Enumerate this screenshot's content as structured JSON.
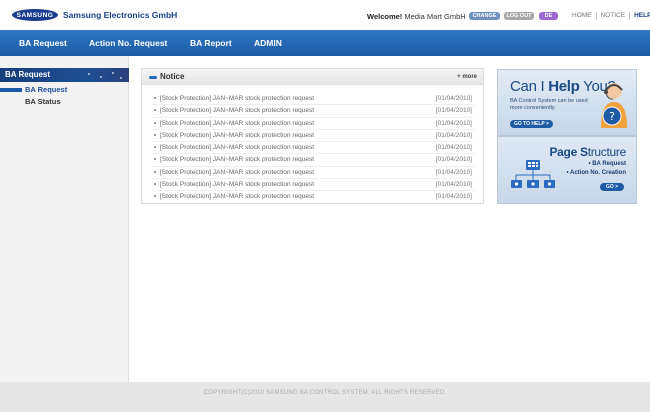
{
  "header": {
    "logo_text": "SAMSUNG",
    "brand": "Samsung Electronics GmbH",
    "welcome_label": "Welcome!",
    "user": "Media Mart GmbH",
    "change_label": "CHANGE",
    "logout_label": "LOG OUT",
    "lang_label": "DE",
    "links": {
      "home": "HOME",
      "notice": "NOTICE",
      "help": "HELP"
    }
  },
  "nav": {
    "items": [
      "BA Request",
      "Action No. Request",
      "BA Report",
      "ADMIN"
    ]
  },
  "sidebar": {
    "title": "BA Request",
    "items": [
      {
        "label": "BA Request",
        "active": true
      },
      {
        "label": "BA Status",
        "active": false
      }
    ]
  },
  "notice": {
    "title": "Notice",
    "more_label": "+ more",
    "items": [
      {
        "text": "[Stock Protection] JAN~MAR stock protection request",
        "date": "[01/04/2010]"
      },
      {
        "text": "[Stock Protection] JAN~MAR stock protection request",
        "date": "[01/04/2010]"
      },
      {
        "text": "[Stock Protection] JAN~MAR stock protection request",
        "date": "[01/04/2010]"
      },
      {
        "text": "[Stock Protection] JAN~MAR stock protection request",
        "date": "[01/04/2010]"
      },
      {
        "text": "[Stock Protection] JAN~MAR stock protection request",
        "date": "[01/04/2010]"
      },
      {
        "text": "[Stock Protection] JAN~MAR stock protection request",
        "date": "[01/04/2010]"
      },
      {
        "text": "[Stock Protection] JAN~MAR stock protection request",
        "date": "[01/04/2010]"
      },
      {
        "text": "[Stock Protection] JAN~MAR stock protection request",
        "date": "[01/04/2010]"
      },
      {
        "text": "[Stock Protection] JAN~MAR stock protection request",
        "date": "[01/04/2010]"
      }
    ]
  },
  "help_banner": {
    "title_pre": "Can I ",
    "title_bold": "Help",
    "title_post": " You?",
    "description": "BA Control System can be used more conveniently.",
    "button_label": "GO TO HELP >"
  },
  "page_banner": {
    "title_bold": "Page S",
    "title_rest": "tructure",
    "items": [
      "• BA Request",
      "• Action No. Creation"
    ],
    "button_label": "GO >"
  },
  "footer": {
    "copyright": "COPYRIGHT(C)2010 SAMSUNG BA CONTROL SYSTEM. ALL RIGHTS RESERVED."
  },
  "colors": {
    "nav": "#1c5aa3",
    "brand": "#1b3f8b",
    "change": "#6f8fbf",
    "logout": "#a9a9a9",
    "lang": "#9a6ad0"
  }
}
